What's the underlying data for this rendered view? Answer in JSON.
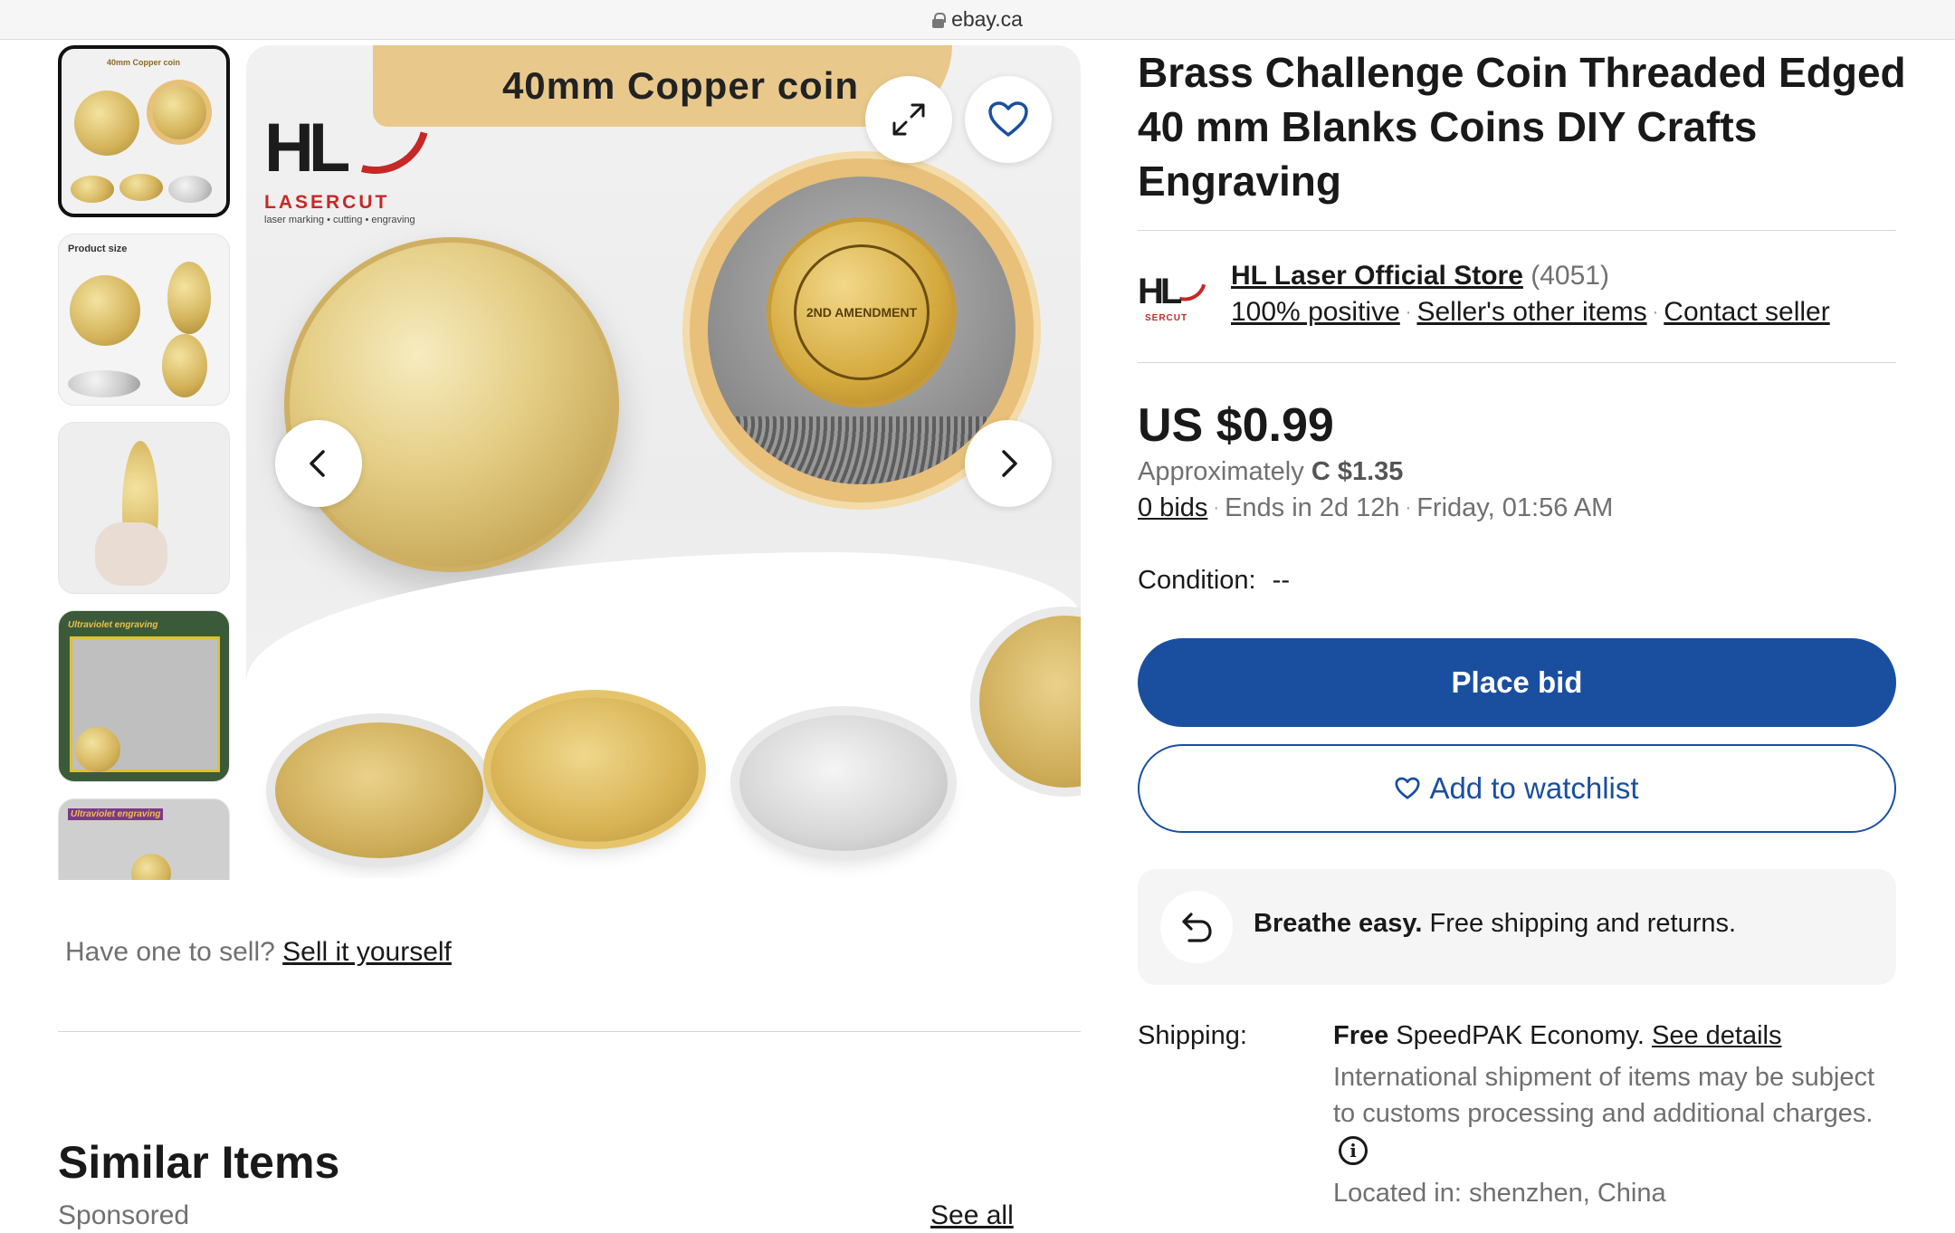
{
  "browser": {
    "domain": "ebay.ca"
  },
  "gallery": {
    "thumbnails": [
      {
        "caption": "40mm Copper coin"
      },
      {
        "caption": "Product size"
      },
      {
        "caption": ""
      },
      {
        "caption": "Ultraviolet engraving"
      },
      {
        "caption": "Ultraviolet engraving"
      }
    ],
    "main_image": {
      "banner_text": "40mm Copper coin",
      "logo_letters": "HL",
      "logo_name": "LASERCUT",
      "logo_tagline": "laser marking • cutting • engraving",
      "engraved_coin_text": "2ND AMENDMENT"
    }
  },
  "listing": {
    "title": "Brass Challenge Coin Threaded Edged 40 mm Blanks Coins DIY Crafts Engraving",
    "seller": {
      "logo_letters": "HL",
      "logo_sub": "SERCUT",
      "name": "HL Laser Official Store",
      "feedback_count": "(4051)",
      "positive": "100% positive",
      "other_items": "Seller's other items",
      "contact": "Contact seller"
    },
    "price": "US $0.99",
    "approx_label": "Approximately",
    "approx_value": "C $1.35",
    "bids": "0 bids",
    "ends_in": "Ends in 2d 12h",
    "end_time": "Friday, 01:56 AM",
    "condition_label": "Condition:",
    "condition_value": "--",
    "place_bid": "Place bid",
    "add_watchlist": "Add to watchlist",
    "breathe_bold": "Breathe easy.",
    "breathe_text": "Free shipping and returns.",
    "shipping_label": "Shipping:",
    "shipping_free": "Free",
    "shipping_service": "SpeedPAK Economy.",
    "see_details": "See details",
    "shipping_note": "International shipment of items may be subject to customs processing and additional charges.",
    "located": "Located in: shenzhen, China"
  },
  "left": {
    "sell_prompt": "Have one to sell?",
    "sell_link": "Sell it yourself",
    "similar_title": "Similar Items",
    "sponsored": "Sponsored",
    "see_all": "See all"
  },
  "colors": {
    "primary_blue": "#1a4fa0",
    "text": "#191919",
    "muted": "#707070",
    "logo_red": "#c62828",
    "banner_gold": "#e9c98b"
  }
}
